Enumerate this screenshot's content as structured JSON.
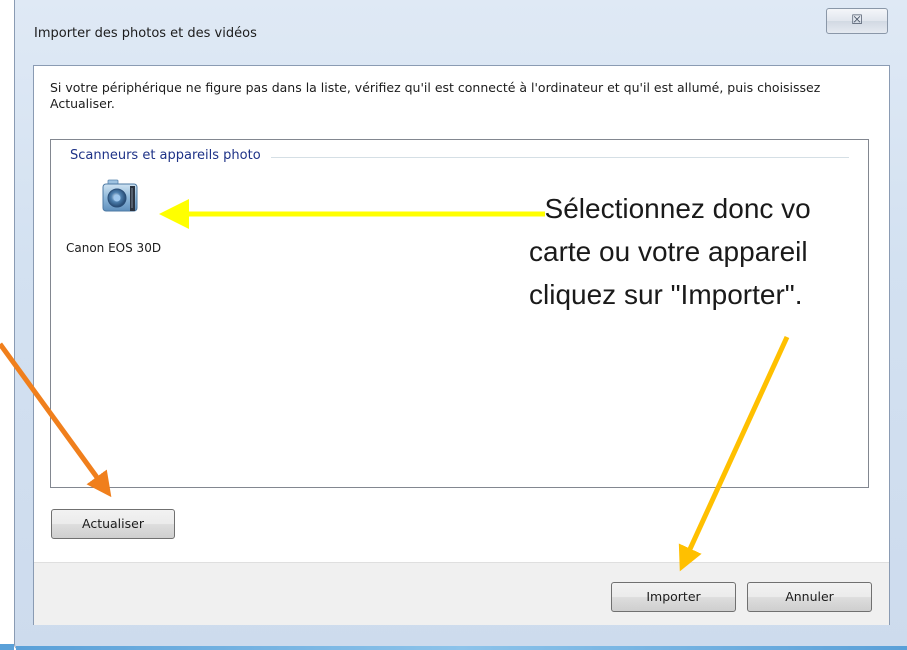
{
  "window": {
    "title": "Importer des photos et des vidéos",
    "close_glyph": "☒"
  },
  "instructions": "Si votre périphérique ne figure pas dans la liste, vérifiez qu'il est connecté à l'ordinateur et qu'il est allumé, puis choisissez Actualiser.",
  "device_list": {
    "group_header": "Scanneurs et appareils photo",
    "items": [
      {
        "label": "Canon EOS 30D",
        "icon": "camera-icon"
      }
    ]
  },
  "buttons": {
    "refresh": "Actualiser",
    "import": "Importer",
    "cancel": "Annuler"
  },
  "annotation": {
    "lines": [
      "  Sélectionnez donc vo",
      "carte ou votre appareil",
      "cliquez sur \"Importer\"."
    ]
  },
  "colors": {
    "yellow_arrow": "#ffff00",
    "orange_arrow": "#f07f1c",
    "gold_arrow": "#ffc000"
  }
}
